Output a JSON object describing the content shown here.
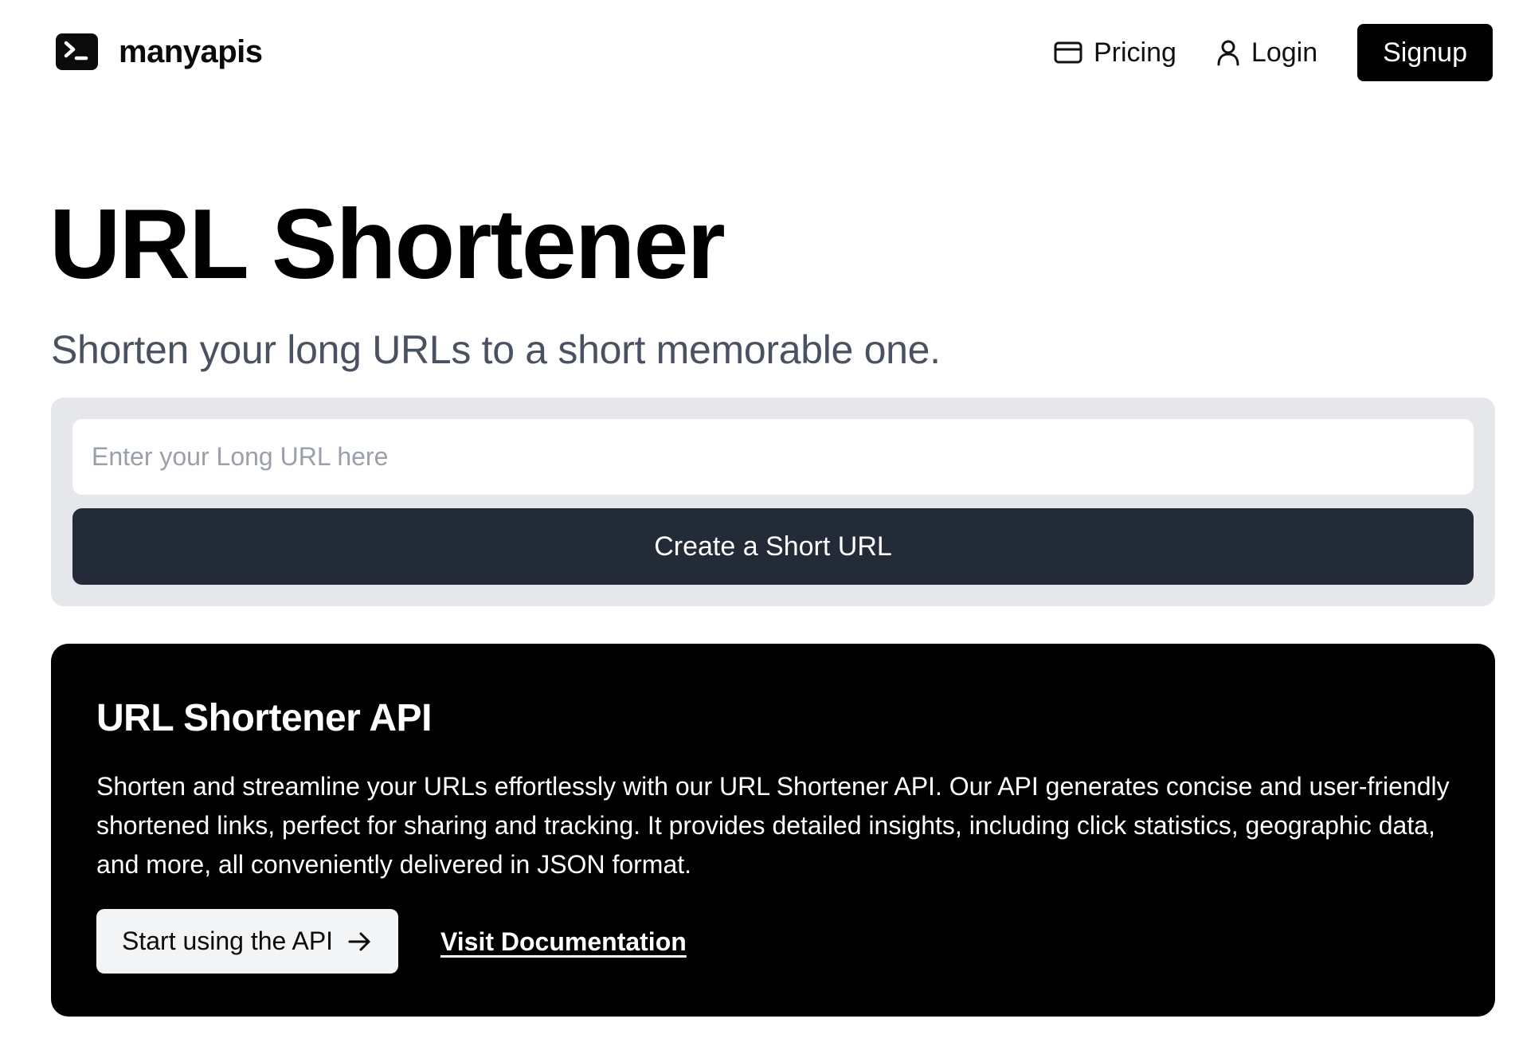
{
  "header": {
    "brand": "manyapis",
    "nav": {
      "pricing": "Pricing",
      "login": "Login",
      "signup": "Signup"
    }
  },
  "hero": {
    "title": "URL Shortener",
    "subtitle": "Shorten your long URLs to a short memorable one."
  },
  "form": {
    "url_placeholder": "Enter your Long URL here",
    "url_value": "",
    "submit_label": "Create a Short URL"
  },
  "api_section": {
    "title": "URL Shortener API",
    "description": "Shorten and streamline your URLs effortlessly with our URL Shortener API. Our API generates concise and user-friendly shortened links, perfect for sharing and tracking. It provides detailed insights, including click statistics, geographic data, and more, all conveniently delivered in JSON format.",
    "start_button": "Start using the API",
    "docs_link": "Visit Documentation"
  },
  "icons": {
    "logo": "terminal-icon",
    "pricing": "credit-card-icon",
    "login": "user-icon",
    "start": "arrow-right-icon"
  },
  "colors": {
    "primary_button": "#232a38",
    "form_panel": "#e5e7eb",
    "api_card": "#000000",
    "subtitle": "#4a5160"
  }
}
